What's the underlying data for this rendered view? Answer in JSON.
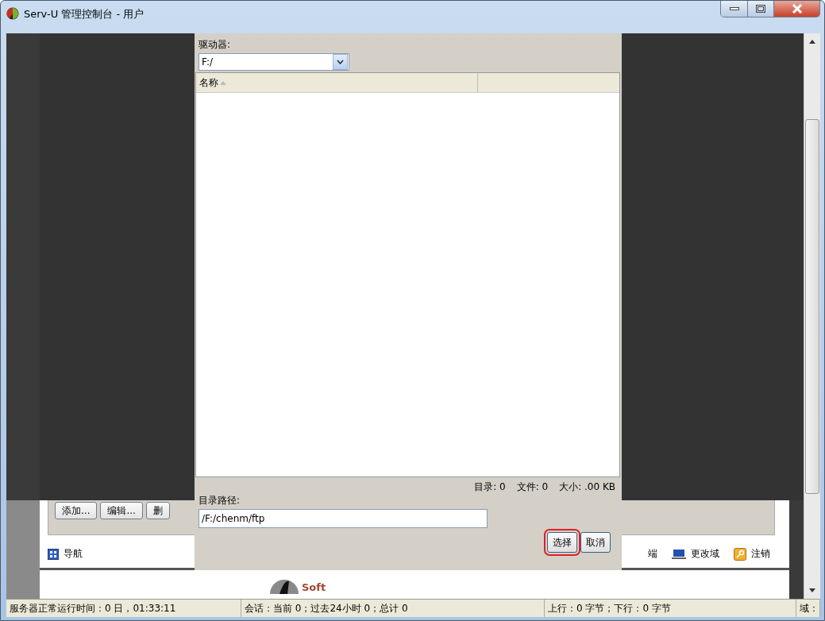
{
  "window": {
    "title": "Serv-U 管理控制台 - 用户"
  },
  "background": {
    "buttons": [
      "添加...",
      "编辑...",
      "删"
    ],
    "toolbar": [
      {
        "label": "导航",
        "kind": "navigation"
      },
      {
        "label": "端",
        "kind": "partial"
      },
      {
        "label": "更改域",
        "kind": "domain"
      },
      {
        "label": "注销",
        "kind": "logout"
      }
    ],
    "logo_text": "Soft"
  },
  "dialog": {
    "drive_label": "驱动器:",
    "drive_value": "F:/",
    "columns": [
      {
        "label": "名称",
        "sorted": true
      }
    ],
    "stats": [
      "目录: 0",
      "文件: 0",
      "大小: .00 KB"
    ],
    "path_label": "目录路径:",
    "path_value": "/F:/chenm/ftp",
    "buttons": [
      {
        "label": "选择",
        "highlighted": true
      },
      {
        "label": "取消",
        "highlighted": false
      }
    ]
  },
  "status_bar": [
    "服务器正常运行时间：0 日，01:33:11",
    "会话：当前 0；过去24小时 0；总计 0",
    "上行：0 字节；下行：0 字节",
    "域："
  ]
}
